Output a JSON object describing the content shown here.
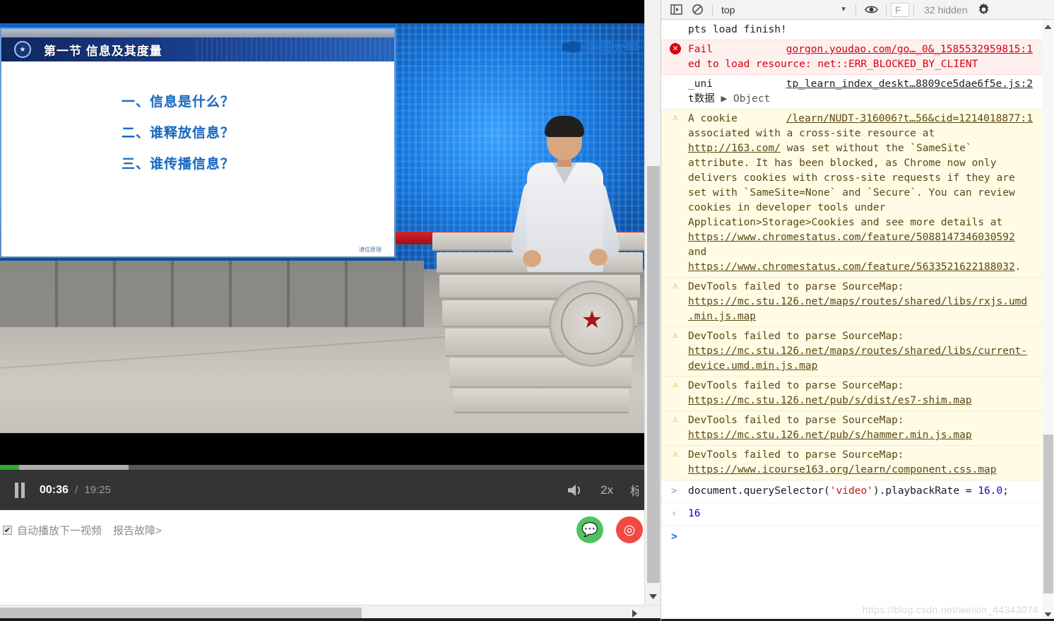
{
  "video": {
    "slide": {
      "title": "第一节 信息及其度量",
      "badge_icon": "shield-emblem-icon",
      "lines": [
        "一、信息是什么？",
        "二、谁释放信息？",
        "三、谁传播信息？"
      ],
      "footnote": "通信原理"
    },
    "watermark": "中国大学",
    "controls": {
      "pause_icon": "pause-icon",
      "current_time": "00:36",
      "separator": "/",
      "total_time": "19:25",
      "volume_icon": "volume-icon",
      "speed": "2x",
      "quality": "标"
    },
    "progress": {
      "played_percent": 3,
      "buffered_percent": 20
    },
    "under": {
      "autoplay_checked": "✔",
      "autoplay_label": "自动播放下一视频",
      "report_label": "报告故障>",
      "share": [
        {
          "name": "wechat",
          "glyph": "💬",
          "color": "#4ec45f"
        },
        {
          "name": "weibo",
          "glyph": "◎",
          "color": "#ef4b43"
        }
      ]
    }
  },
  "devtools": {
    "toolbar": {
      "sidebar_icon": "console-sidebar-icon",
      "clear_icon": "clear-console-icon",
      "context": "top",
      "caret": "▼",
      "eye_icon": "live-expression-eye-icon",
      "filter_value": "F",
      "hidden_count": "32 hidden",
      "settings_icon": "gear-icon"
    },
    "messages": [
      {
        "kind": "info",
        "severity_icon": "",
        "text": "pts load finish!",
        "source": ""
      },
      {
        "kind": "error",
        "severity_icon": "✕",
        "text": "Fail",
        "text2": "ed to load resource: net::ERR_BLOCKED_BY_CLIENT",
        "source": "gorgon.youdao.com/go…_0&_1585532959815:1"
      },
      {
        "kind": "info",
        "severity_icon": "",
        "text": "_uni",
        "text2": "t数据",
        "object_toggle": "▶ Object",
        "source": "tp_learn_index_deskt…8809ce5dae6f5e.js:2"
      },
      {
        "kind": "warn",
        "severity_icon": "⚠",
        "text": "A",
        "text2": "cookie associated with a cross-site resource at ",
        "link1": "http://163.com/",
        "text3": " was set without the `SameSite` attribute. It has been blocked, as Chrome now only delivers cookies with cross-site requests if they are set with `SameSite=None` and `Secure`. You can review cookies in developer tools under Application>Storage>Cookies and see more details at ",
        "link2": "https://www.chromestatus.com/feature/5088147346030592",
        "text4": " and ",
        "link3": "https://www.chromestatus.com/feature/5633521622188032",
        "text5": ".",
        "source": "/learn/NUDT-316006?t…56&cid=1214018877:1"
      },
      {
        "kind": "warn",
        "severity_icon": "⚠",
        "text": "DevTools failed to parse SourceMap: ",
        "link1": "https://mc.stu.126.net/maps/routes/shared/libs/rxjs.umd.min.js.map",
        "source": ""
      },
      {
        "kind": "warn",
        "severity_icon": "⚠",
        "text": "DevTools failed to parse SourceMap: ",
        "link1": "https://mc.stu.126.net/maps/routes/shared/libs/current-device.umd.min.js.map",
        "source": ""
      },
      {
        "kind": "warn",
        "severity_icon": "⚠",
        "text": "DevTools failed to parse SourceMap: ",
        "link1": "https://mc.stu.126.net/pub/s/dist/es7-shim.map",
        "source": ""
      },
      {
        "kind": "warn",
        "severity_icon": "⚠",
        "text": "DevTools failed to parse SourceMap: ",
        "link1": "https://mc.stu.126.net/pub/s/hammer.min.js.map",
        "source": ""
      },
      {
        "kind": "warn",
        "severity_icon": "⚠",
        "text": "DevTools failed to parse SourceMap: ",
        "link1": "https://www.icourse163.org/learn/component.css.map",
        "source": ""
      }
    ],
    "command": {
      "caret": ">",
      "part1": "document.querySelector(",
      "string": "'video'",
      "part2": ").playbackRate =",
      "number": "16.0",
      "part3": ";"
    },
    "result": {
      "caret": "‹",
      "value": "16"
    },
    "prompt": {
      "caret": ">"
    },
    "watermark": "https://blog.csdn.net/weixin_44343074"
  }
}
